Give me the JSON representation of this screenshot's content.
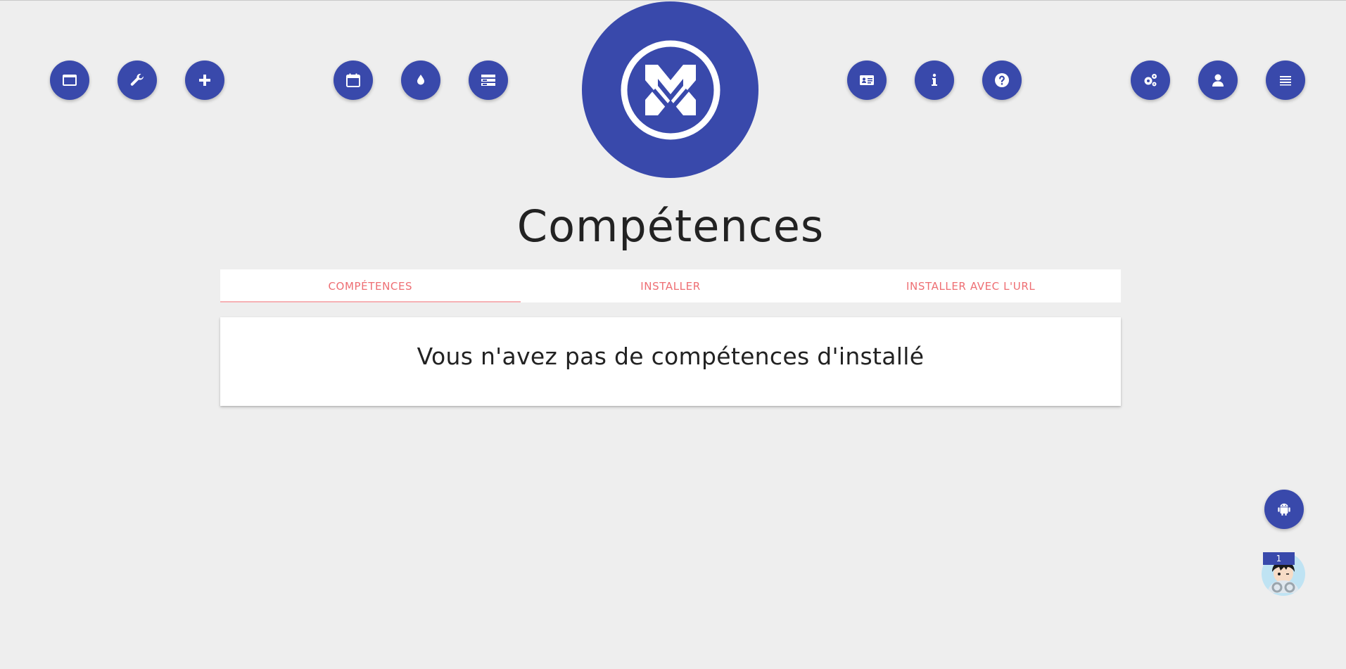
{
  "nav": {
    "left": [
      {
        "name": "window-icon"
      },
      {
        "name": "wrench-icon"
      },
      {
        "name": "plus-icon"
      }
    ],
    "center_left": [
      {
        "name": "calendar-icon"
      },
      {
        "name": "droplet-icon"
      },
      {
        "name": "list-icon"
      }
    ],
    "center_right": [
      {
        "name": "id-card-icon"
      },
      {
        "name": "info-icon"
      },
      {
        "name": "question-icon"
      }
    ],
    "right": [
      {
        "name": "gears-icon"
      },
      {
        "name": "user-icon"
      },
      {
        "name": "menu-icon"
      }
    ]
  },
  "colors": {
    "primary": "#3949ab",
    "tab_text": "#ee6e73",
    "background": "#eeeeee"
  },
  "page": {
    "title": "Compétences"
  },
  "tabs": [
    {
      "label": "Compétences",
      "active": true
    },
    {
      "label": "Installer",
      "active": false
    },
    {
      "label": "Installer avec l'URL",
      "active": false
    }
  ],
  "content": {
    "empty_message": "Vous n'avez pas de compétences d'installé"
  },
  "notifications": {
    "count": "1"
  },
  "floating": {
    "android_icon": "android-icon",
    "avatar_icon": "avatar"
  }
}
